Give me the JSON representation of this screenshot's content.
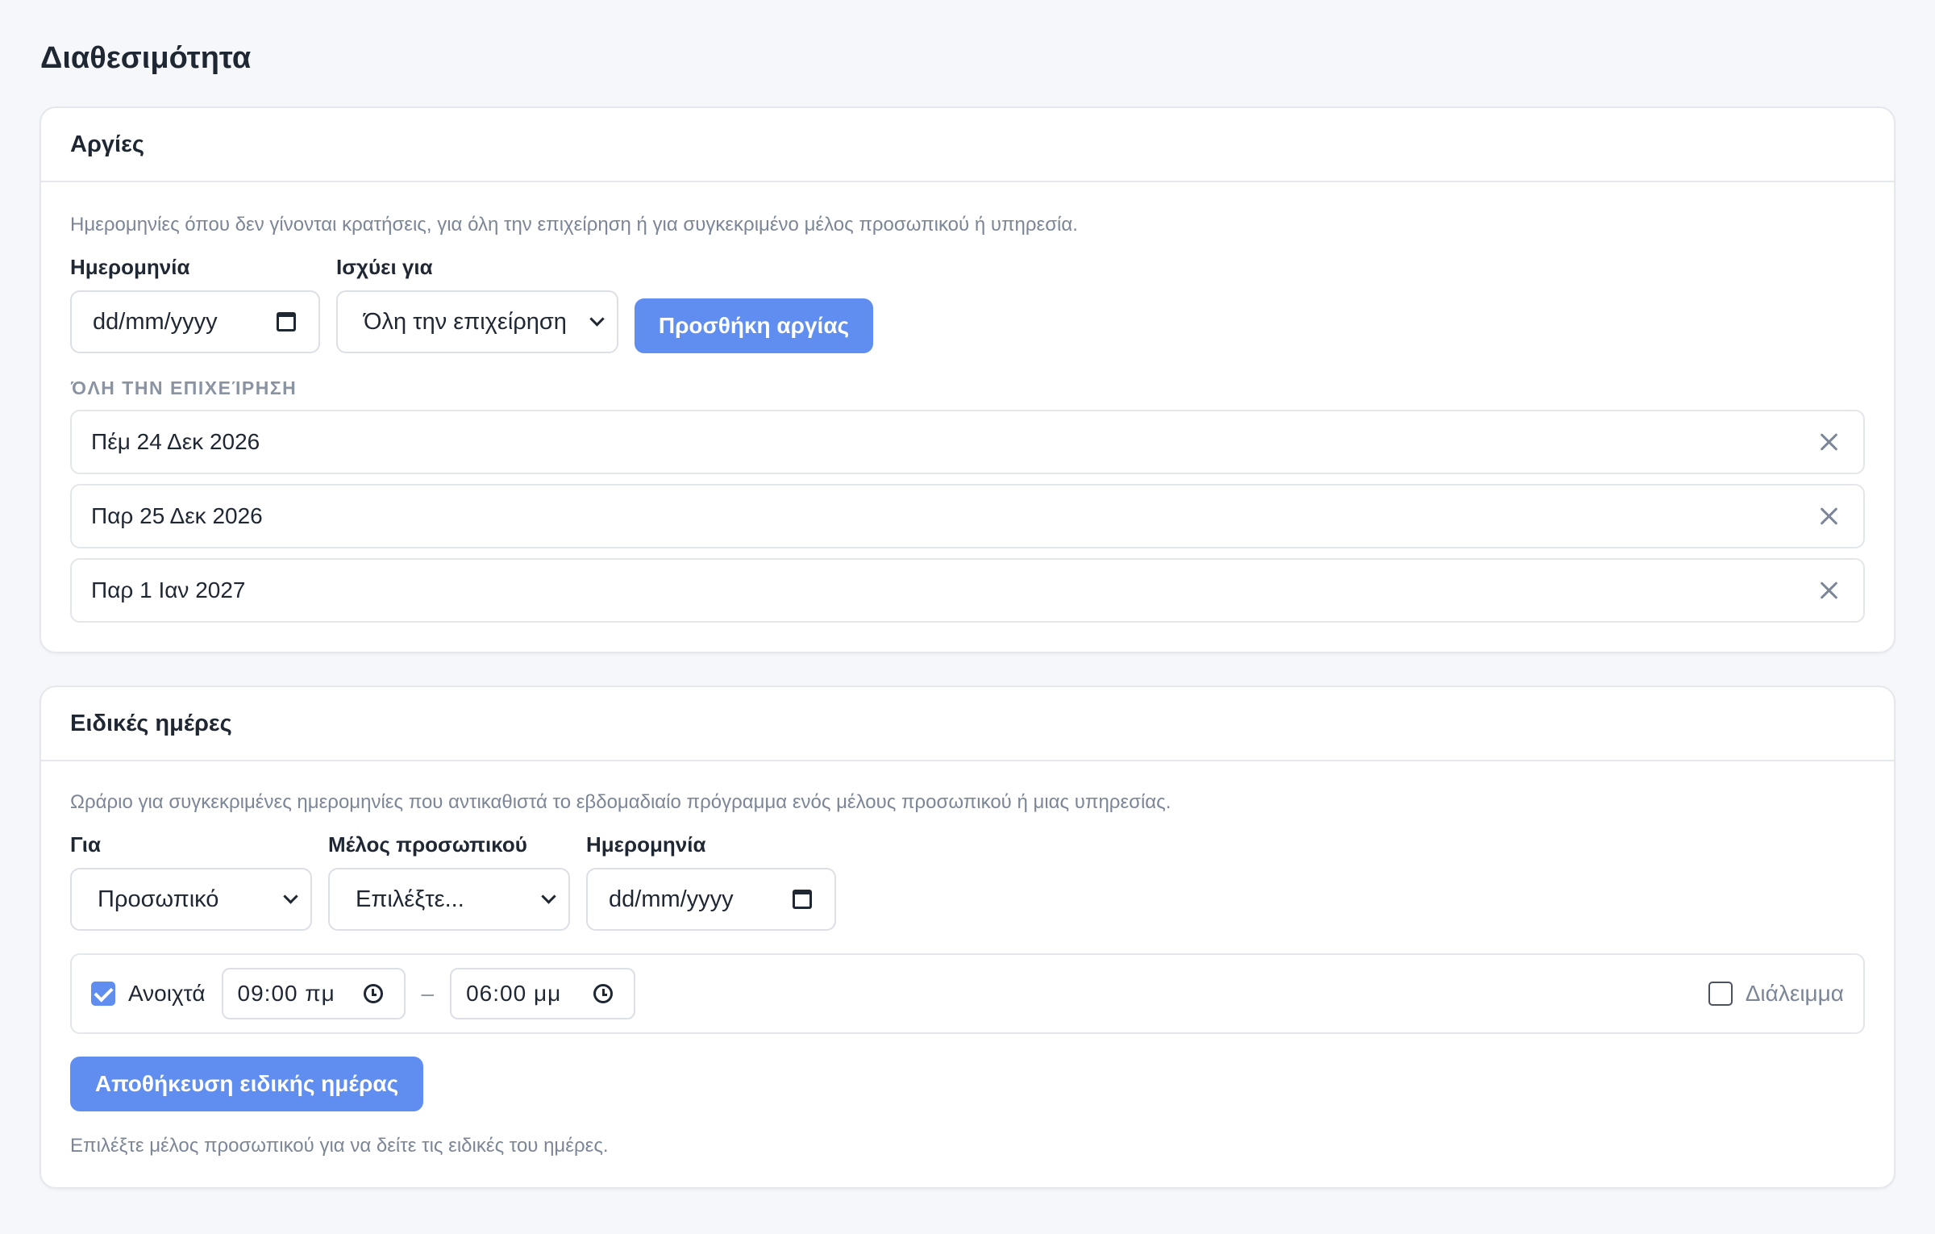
{
  "page": {
    "title": "Διαθεσιμότητα"
  },
  "holidays": {
    "title": "Αργίες",
    "description": "Ημερομηνίες όπου δεν γίνονται κρατήσεις, για όλη την επιχείρηση ή για συγκεκριμένο μέλος προσωπικού ή υπηρεσία.",
    "date_label": "Ημερομηνία",
    "date_value": "dd/mm/yyyy",
    "applies_label": "Ισχύει για",
    "applies_value": "Όλη την επιχείρηση",
    "add_button": "Προσθήκη αργίας",
    "group_label": "ΌΛΗ ΤΗΝ ΕΠΙΧΕΊΡΗΣΗ",
    "items": [
      {
        "label": "Πέμ 24 Δεκ 2026"
      },
      {
        "label": "Παρ 25 Δεκ 2026"
      },
      {
        "label": "Παρ 1 Ιαν 2027"
      }
    ]
  },
  "special_days": {
    "title": "Ειδικές ημέρες",
    "description": "Ωράριο για συγκεκριμένες ημερομηνίες που αντικαθιστά το εβδομαδιαίο πρόγραμμα ενός μέλους προσωπικού ή μιας υπηρεσίας.",
    "for_label": "Για",
    "for_value": "Προσωπικό",
    "staff_label": "Μέλος προσωπικού",
    "staff_value": "Επιλέξτε...",
    "date_label": "Ημερομηνία",
    "date_value": "dd/mm/yyyy",
    "open_label": "Ανοιχτά",
    "open_checked": true,
    "time_from": "09:00 πμ",
    "time_separator": "–",
    "time_to": "06:00 μμ",
    "break_label": "Διάλειμμα",
    "break_checked": false,
    "save_button": "Αποθήκευση ειδικής ημέρας",
    "note": "Επιλέξτε μέλος προσωπικού για να δείτε τις ειδικές του ημέρες."
  },
  "colors": {
    "accent": "#5f8ef0",
    "background": "#f6f7fa",
    "muted_text": "#7c8696"
  }
}
